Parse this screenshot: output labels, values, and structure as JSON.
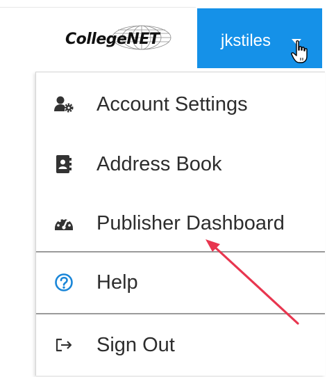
{
  "header": {
    "logo_text": "CollegeNET",
    "user_name": "jkstiles"
  },
  "icons": {
    "caret": "caret-down-icon",
    "cursor": "hand-pointer-cursor-icon"
  },
  "menu": {
    "items": [
      {
        "label": "Account Settings",
        "icon": "user-gear-icon"
      },
      {
        "label": "Address Book",
        "icon": "address-book-icon"
      },
      {
        "label": "Publisher Dashboard",
        "icon": "gauge-icon"
      },
      {
        "label": "Help",
        "icon": "question-circle-icon"
      },
      {
        "label": "Sign Out",
        "icon": "sign-out-icon"
      }
    ]
  },
  "colors": {
    "user_button_bg": "#1591e8",
    "help_icon": "#1a86d8",
    "annotation_arrow": "#e8364f",
    "menu_text": "#2d2d2d"
  }
}
